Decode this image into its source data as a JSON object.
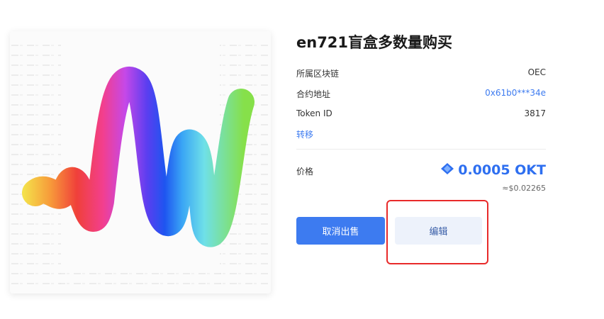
{
  "title": "en721盲盒多数量购买",
  "details": [
    {
      "label": "所属区块链",
      "value": "OEC"
    },
    {
      "label": "合约地址",
      "value": "0x61b0***34e"
    },
    {
      "label": "Token ID",
      "value": "3817"
    }
  ],
  "transfer_link": "转移",
  "price": {
    "label": "价格",
    "value": "0.0005 OKT",
    "fiat": "≈$0.02265",
    "icon": "okt-token-icon"
  },
  "buttons": {
    "cancel_sale": "取消出售",
    "edit": "编辑"
  },
  "colors": {
    "accent": "#3d7bf0",
    "highlight": "#e82a2a",
    "edit_bg": "#edf2fb"
  }
}
